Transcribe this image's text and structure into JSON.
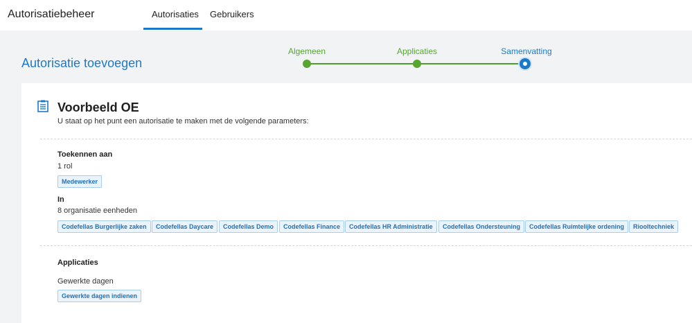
{
  "header": {
    "app_title": "Autorisatiebeheer",
    "tabs": [
      {
        "label": "Autorisaties",
        "active": true
      },
      {
        "label": "Gebruikers",
        "active": false
      }
    ]
  },
  "page": {
    "title": "Autorisatie toevoegen"
  },
  "stepper": {
    "steps": [
      {
        "label": "Algemeen",
        "state": "done"
      },
      {
        "label": "Applicaties",
        "state": "done"
      },
      {
        "label": "Samenvatting",
        "state": "active"
      }
    ],
    "colors": {
      "done": "#55a630",
      "active": "#1b79c9"
    }
  },
  "summary": {
    "icon": "clipboard-icon",
    "title": "Voorbeeld OE",
    "subtitle": "U staat op het punt een autorisatie te maken met de volgende parameters:",
    "assign": {
      "heading": "Toekennen aan",
      "count_text": "1 rol",
      "roles": [
        "Medewerker"
      ]
    },
    "in": {
      "heading": "In",
      "count_text": "8 organisatie eenheden",
      "units": [
        "Codefellas Burgerlijke zaken",
        "Codefellas Daycare",
        "Codefellas Demo",
        "Codefellas Finance",
        "Codefellas HR Administratie",
        "Codefellas Ondersteuning",
        "Codefellas Ruimtelijke ordening",
        "Riooltechniek"
      ]
    },
    "applications": {
      "heading": "Applicaties",
      "items": [
        {
          "name": "Gewerkte dagen",
          "permissions": [
            "Gewerkte dagen indienen"
          ]
        }
      ]
    }
  },
  "colors": {
    "accent": "#1b79c9",
    "success": "#55a630",
    "chip_bg": "#eaf4fd",
    "chip_border": "#a7cdef",
    "page_bg": "#f2f3f5"
  }
}
